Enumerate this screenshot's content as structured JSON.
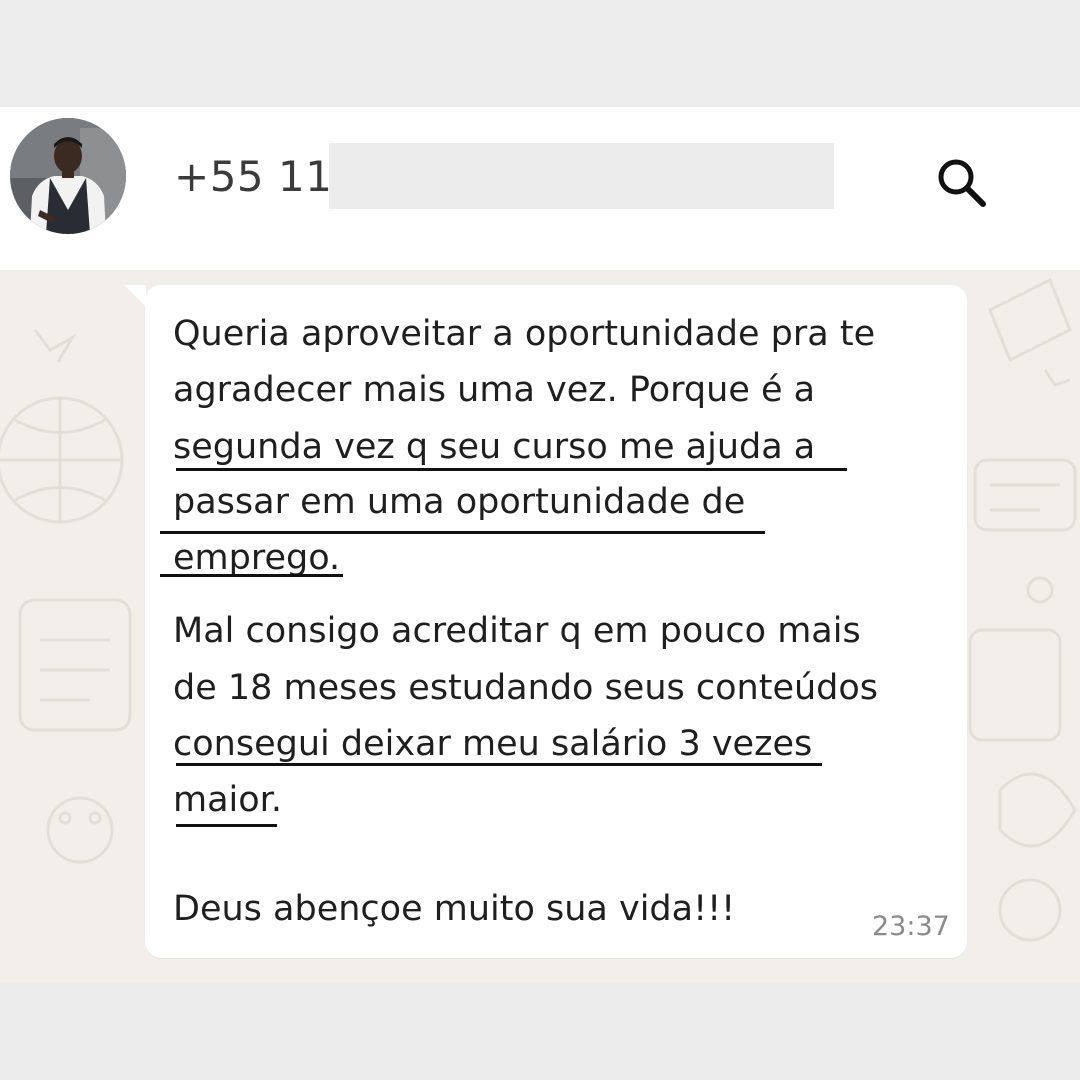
{
  "contact": {
    "phone_prefix": "+55 11",
    "avatar_icon": "profile-photo"
  },
  "header": {
    "search_icon": "search-icon"
  },
  "message": {
    "lines": [
      "Queria aproveitar a oportunidade pra te",
      "agradecer mais uma vez. Porque é a",
      "segunda vez q seu curso me ajuda a",
      "passar em uma oportunidade de",
      "emprego.",
      "Mal consigo acreditar q em pouco mais",
      "de 18 meses estudando seus conteúdos",
      "consegui deixar meu salário 3 vezes",
      "maior.",
      "Deus abençoe muito sua vida!!!"
    ],
    "time": "23:37"
  },
  "colors": {
    "chat_background": "#f2efea",
    "bubble": "#ffffff",
    "underline": "#111111"
  }
}
